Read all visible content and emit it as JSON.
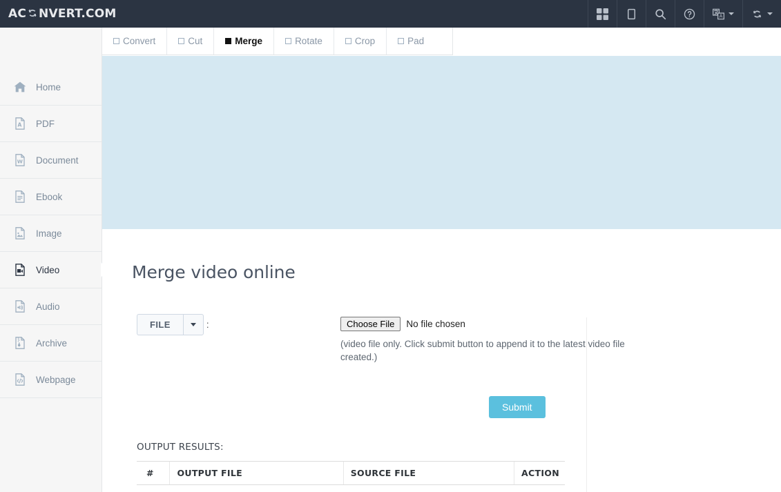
{
  "header": {
    "brand_pre": "AC",
    "brand_post": "NVERT.COM",
    "brand_icon": "refresh-icon",
    "actions": [
      {
        "name": "apps-grid-button",
        "icon": "grid-icon",
        "caret": false
      },
      {
        "name": "device-button",
        "icon": "tablet-icon",
        "caret": false
      },
      {
        "name": "search-button",
        "icon": "search-icon",
        "caret": false
      },
      {
        "name": "help-button",
        "icon": "question-circle-icon",
        "caret": false
      },
      {
        "name": "language-button",
        "icon": "language-icon",
        "caret": true
      },
      {
        "name": "convert-button",
        "icon": "refresh-icon",
        "caret": true
      }
    ]
  },
  "sidebar": {
    "items": [
      {
        "label": "Home",
        "icon": "home-icon",
        "active": false
      },
      {
        "label": "PDF",
        "icon": "file-pdf-icon",
        "active": false
      },
      {
        "label": "Document",
        "icon": "file-word-icon",
        "active": false
      },
      {
        "label": "Ebook",
        "icon": "file-text-icon",
        "active": false
      },
      {
        "label": "Image",
        "icon": "file-image-icon",
        "active": false
      },
      {
        "label": "Video",
        "icon": "file-video-icon",
        "active": true
      },
      {
        "label": "Audio",
        "icon": "file-audio-icon",
        "active": false
      },
      {
        "label": "Archive",
        "icon": "file-archive-icon",
        "active": false
      },
      {
        "label": "Webpage",
        "icon": "file-code-icon",
        "active": false
      }
    ]
  },
  "tabs": [
    {
      "label": "Convert",
      "active": false
    },
    {
      "label": "Cut",
      "active": false
    },
    {
      "label": "Merge",
      "active": true
    },
    {
      "label": "Rotate",
      "active": false
    },
    {
      "label": "Crop",
      "active": false
    },
    {
      "label": "Pad",
      "active": false
    }
  ],
  "main": {
    "title": "Merge video online",
    "source_type_label": "FILE",
    "source_type_colon": ":",
    "choose_file_label": "Choose File",
    "no_file_text": "No file chosen",
    "hint": "(video file only. Click submit button to append it to the latest video file created.)",
    "submit_label": "Submit",
    "results_label": "OUTPUT RESULTS:",
    "table": {
      "columns": [
        "#",
        "OUTPUT FILE",
        "SOURCE FILE",
        "ACTION"
      ],
      "rows": []
    }
  },
  "colors": {
    "header_bg": "#2b3442",
    "banner_bg": "#d5e8f2",
    "submit_bg": "#5bc0de",
    "sidebar_bg": "#f6f6f6",
    "sidebar_text": "#7b8a9a"
  }
}
